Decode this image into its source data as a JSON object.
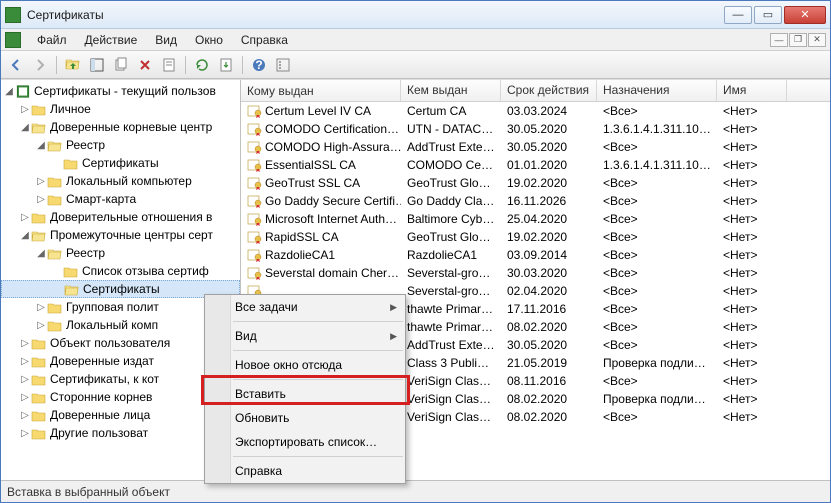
{
  "window": {
    "title": "Сертификаты"
  },
  "menubar": {
    "file": "Файл",
    "action": "Действие",
    "view": "Вид",
    "window": "Окно",
    "help": "Справка"
  },
  "tree": {
    "root": "Сертификаты - текущий пользов",
    "personal": "Личное",
    "trusted_root": "Доверенные корневые центр",
    "registry": "Реестр",
    "certificates": "Сертификаты",
    "local_computer": "Локальный компьютер",
    "smart_card": "Смарт-карта",
    "trusted_rel": "Доверительные отношения в",
    "intermediate": "Промежуточные центры серт",
    "crl": "Список отзыва сертиф",
    "group_policy": "Групповая полит",
    "local_comp2": "Локальный комп",
    "user_object": "Объект пользователя",
    "trusted_pub": "Доверенные издат",
    "certs_no_trust": "Сертификаты, к кот",
    "third_party": "Сторонние корнев",
    "trusted_persons": "Доверенные лица",
    "other": "Другие пользоват"
  },
  "columns": {
    "issued_to": "Кому выдан",
    "issued_by": "Кем выдан",
    "expiry": "Срок действия",
    "purpose": "Назначения",
    "name": "Имя"
  },
  "rows": [
    {
      "to": "Certum Level IV CA",
      "by": "Certum CA",
      "exp": "03.03.2024",
      "pur": "<Все>",
      "nm": "<Нет>"
    },
    {
      "to": "COMODO Certification…",
      "by": "UTN - DATACo…",
      "exp": "30.05.2020",
      "pur": "1.3.6.1.4.1.311.10.3…",
      "nm": "<Нет>"
    },
    {
      "to": "COMODO High-Assura…",
      "by": "AddTrust Exter…",
      "exp": "30.05.2020",
      "pur": "<Все>",
      "nm": "<Нет>"
    },
    {
      "to": "EssentialSSL CA",
      "by": "COMODO Certi…",
      "exp": "01.01.2020",
      "pur": "1.3.6.1.4.1.311.10.3…",
      "nm": "<Нет>"
    },
    {
      "to": "GeoTrust SSL CA",
      "by": "GeoTrust Globa…",
      "exp": "19.02.2020",
      "pur": "<Все>",
      "nm": "<Нет>"
    },
    {
      "to": "Go Daddy Secure Certifi…",
      "by": "Go Daddy Class…",
      "exp": "16.11.2026",
      "pur": "<Все>",
      "nm": "<Нет>"
    },
    {
      "to": "Microsoft Internet Auth…",
      "by": "Baltimore Cybe…",
      "exp": "25.04.2020",
      "pur": "<Все>",
      "nm": "<Нет>"
    },
    {
      "to": "RapidSSL CA",
      "by": "GeoTrust Globa…",
      "exp": "19.02.2020",
      "pur": "<Все>",
      "nm": "<Нет>"
    },
    {
      "to": "RazdolieCA1",
      "by": "RazdolieCA1",
      "exp": "03.09.2014",
      "pur": "<Все>",
      "nm": "<Нет>"
    },
    {
      "to": "Severstal domain Cher…",
      "by": "Severstal-grou…",
      "exp": "30.03.2020",
      "pur": "<Все>",
      "nm": "<Нет>"
    },
    {
      "to": "",
      "by": "Severstal-grou…",
      "exp": "02.04.2020",
      "pur": "<Все>",
      "nm": "<Нет>"
    },
    {
      "to": "",
      "by": "thawte Primary…",
      "exp": "17.11.2016",
      "pur": "<Все>",
      "nm": "<Нет>"
    },
    {
      "to": "",
      "by": "thawte Primary…",
      "exp": "08.02.2020",
      "pur": "<Все>",
      "nm": "<Нет>"
    },
    {
      "to": "",
      "by": "AddTrust Exter…",
      "exp": "30.05.2020",
      "pur": "<Все>",
      "nm": "<Нет>"
    },
    {
      "to": "",
      "by": "Class 3 Public P…",
      "exp": "21.05.2019",
      "pur": "Проверка подлин…",
      "nm": "<Нет>"
    },
    {
      "to": "",
      "by": "VeriSign Class 3…",
      "exp": "08.11.2016",
      "pur": "<Все>",
      "nm": "<Нет>"
    },
    {
      "to": "",
      "by": "VeriSign Class 3…",
      "exp": "08.02.2020",
      "pur": "Проверка подлин…",
      "nm": "<Нет>"
    },
    {
      "to": "",
      "by": "VeriSign Class 3…",
      "exp": "08.02.2020",
      "pur": "<Все>",
      "nm": "<Нет>"
    }
  ],
  "context_menu": {
    "all_tasks": "Все задачи",
    "view": "Вид",
    "new_window": "Новое окно отсюда",
    "paste": "Вставить",
    "refresh": "Обновить",
    "export_list": "Экспортировать список…",
    "help": "Справка"
  },
  "status": "Вставка в выбранный объект"
}
